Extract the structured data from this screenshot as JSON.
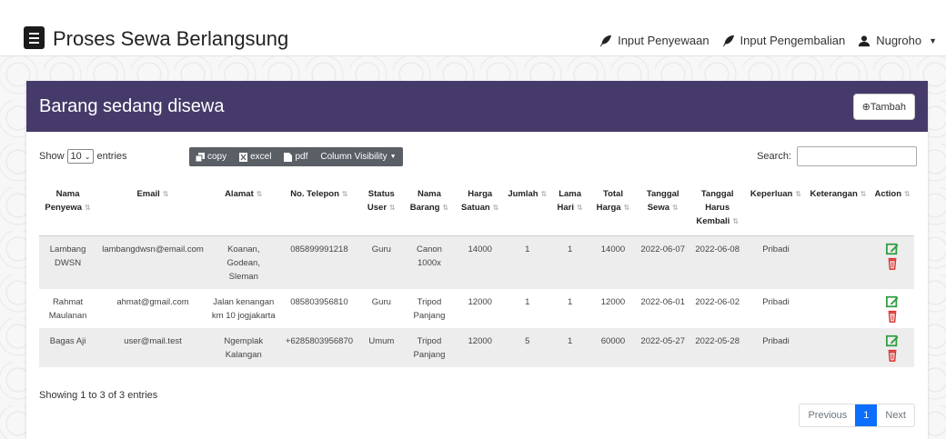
{
  "app": {
    "title": "Proses Sewa Berlangsung"
  },
  "nav": {
    "input_penyewaan": "Input Penyewaan",
    "input_pengembalian": "Input Pengembalian",
    "user": "Nugroho"
  },
  "card": {
    "title": "Barang sedang disewa",
    "tambah_label": "⊕Tambah"
  },
  "toolbar": {
    "show": "Show",
    "entries_value": "10",
    "entries": "entries",
    "copy": "copy",
    "excel": "excel",
    "pdf": "pdf",
    "column_visibility": "Column Visibility",
    "search_label": "Search:",
    "search_value": ""
  },
  "table": {
    "headers": [
      "Nama Penyewa",
      "Email",
      "Alamat",
      "No. Telepon",
      "Status User",
      "Nama Barang",
      "Harga Satuan",
      "Jumlah",
      "Lama Hari",
      "Total Harga",
      "Tanggal Sewa",
      "Tanggal Harus Kembali",
      "Keperluan",
      "Keterangan",
      "Action"
    ],
    "rows": [
      [
        "Lambang DWSN",
        "lambangdwsn@email.com",
        "Koanan, Godean, Sleman",
        "085899991218",
        "Guru",
        "Canon 1000x",
        "14000",
        "1",
        "1",
        "14000",
        "2022-06-07",
        "2022-06-08",
        "Pribadi",
        ""
      ],
      [
        "Rahmat Maulanan",
        "ahmat@gmail.com",
        "Jalan kenangan km 10 jogjakarta",
        "085803956810",
        "Guru",
        "Tripod Panjang",
        "12000",
        "1",
        "1",
        "12000",
        "2022-06-01",
        "2022-06-02",
        "Pribadi",
        ""
      ],
      [
        "Bagas Aji",
        "user@mail.test",
        "Ngemplak Kalangan",
        "+6285803956870",
        "Umum",
        "Tripod Panjang",
        "12000",
        "5",
        "1",
        "60000",
        "2022-05-27",
        "2022-05-28",
        "Pribadi",
        ""
      ]
    ]
  },
  "footer": {
    "info": "Showing 1 to 3 of 3 entries",
    "previous": "Previous",
    "page": "1",
    "next": "Next"
  },
  "colors": {
    "header_bg": "#463a6a",
    "edit": "#2e9d3e",
    "delete": "#d9302c",
    "active_page": "#0d6efd"
  }
}
